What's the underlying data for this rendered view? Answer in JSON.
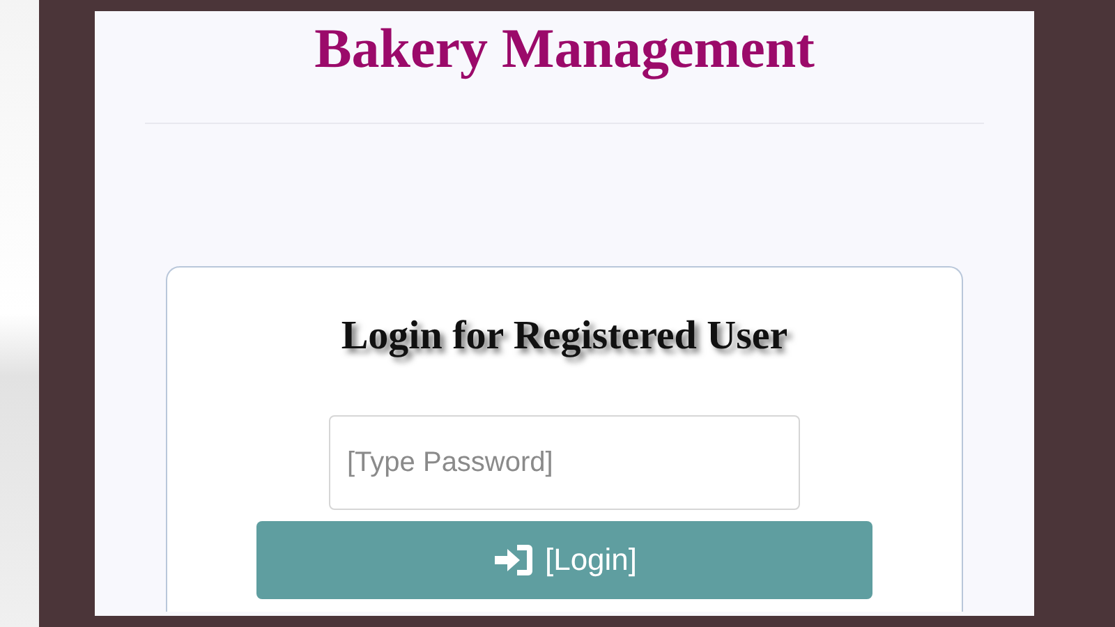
{
  "header": {
    "title": "Bakery Management"
  },
  "login": {
    "heading": "Login for Registered User",
    "password": {
      "placeholder": "[Type Password]"
    },
    "button": {
      "label": "[Login]"
    }
  }
}
